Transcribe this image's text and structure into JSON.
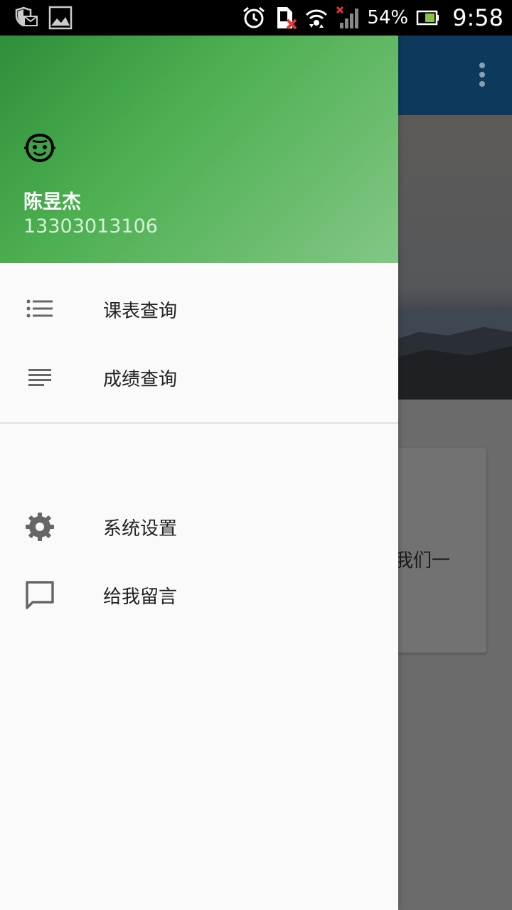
{
  "status_bar": {
    "battery_percent": "54%",
    "time": "9:58",
    "icons": [
      "shield-mail-icon",
      "image-icon",
      "alarm-icon",
      "sim-error-icon",
      "wifi-icon",
      "signal-icon",
      "battery-icon"
    ]
  },
  "background_app": {
    "card_text": "我们一",
    "toolbar_color": "#0d3a5c"
  },
  "drawer": {
    "header": {
      "user_name": "陈昱杰",
      "user_phone": "13303013106",
      "avatar_icon": "face-icon",
      "gradient_colors": [
        "#2f8e3a",
        "#4caf50",
        "#82c785"
      ]
    },
    "menu_primary": [
      {
        "icon": "list-icon",
        "label": "课表查询"
      },
      {
        "icon": "notes-icon",
        "label": "成绩查询"
      }
    ],
    "menu_secondary": [
      {
        "icon": "settings-icon",
        "label": "系统设置"
      },
      {
        "icon": "message-icon",
        "label": "给我留言"
      }
    ]
  }
}
